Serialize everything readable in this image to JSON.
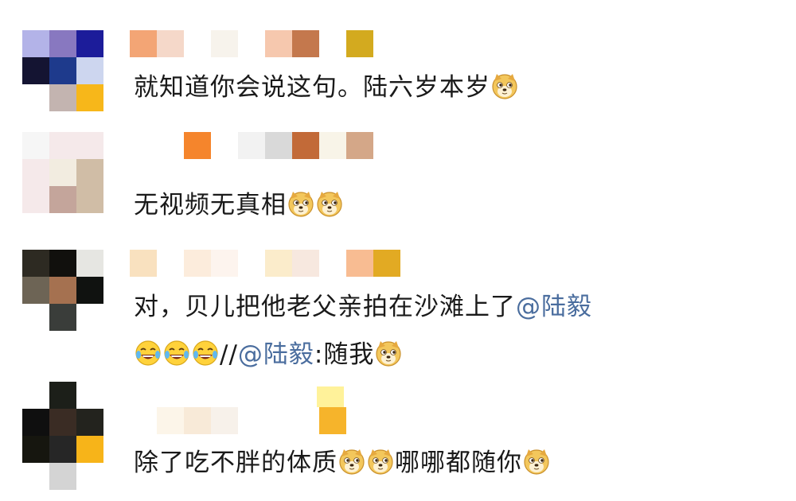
{
  "comments": [
    {
      "avatar_colors": [
        "#b3b3e8",
        "#8878c0",
        "#1c1c9a",
        "#141432",
        "#1e3a8c",
        "#cdd6ef",
        "#ffffff",
        "#c3b4b0",
        "#f7b71a"
      ],
      "name_colors": [
        "#f3a575",
        "#f5d8c9",
        "#ffffff",
        "#f7f3ec",
        "#ffffff",
        "#f6c8ae",
        "#c4784d",
        "#ffffff",
        "#d3aa1f"
      ],
      "line1": "就知道你会说这句。陆六岁本岁"
    },
    {
      "avatar_colors": [
        "#f6f6f6",
        "#f5e9ea",
        "#f5e9ea",
        "#f5e9ea",
        "#f2ece0",
        "#d0bda6",
        "#f5e9ea",
        "#c4a59b",
        "#d0bda6"
      ],
      "name_colors": [
        "#ffffff",
        "#ffffff",
        "#f5852c",
        "#ffffff",
        "#f2f2f2",
        "#d9d9d9",
        "#c26a38",
        "#f8f4e8",
        "#d4a788"
      ],
      "line1": "无视频无真相"
    },
    {
      "avatar_colors": [
        "#2d2a22",
        "#11100d",
        "#e6e6e2",
        "#6d6455",
        "#a57150",
        "#101210",
        "#ffffff",
        "#3a3d3a",
        "#ffffff"
      ],
      "name_colors": [
        "#f9e1bf",
        "#ffffff",
        "#fcecdc",
        "#fdf4ee",
        "#ffffff",
        "#fbeccb",
        "#f7e8df",
        "#ffffff",
        "#f8bc92",
        "#e2aa23"
      ],
      "line1_text": "对，贝儿把他老父亲拍在沙滩上了",
      "line1_mention": "@陆毅",
      "line2_sep": "//",
      "line2_mention": "@陆毅",
      "line2_text": ":随我"
    },
    {
      "avatar_colors": [
        "#ffffff",
        "#1c1f19",
        "#ffffff",
        "#0f0f0f",
        "#3a2c24",
        "#23231e",
        "#16160f",
        "#262626",
        "#f7b419"
      ],
      "extra_avatar_color": "#d4d4d4",
      "name_colors": [
        "#ffffff",
        "#fcf5e9",
        "#f8ead8",
        "#f7f1ea",
        "#ffffff",
        "#ffffff",
        "#ffffff",
        "#f6b42b"
      ],
      "name_top_color": "#fff29a",
      "line1_a": "除了吃不胖的体质",
      "line1_b": "哪哪都随你"
    }
  ],
  "emoji_names": {
    "doge": "doge-icon",
    "laugh_cry": "laugh-cry-icon"
  }
}
